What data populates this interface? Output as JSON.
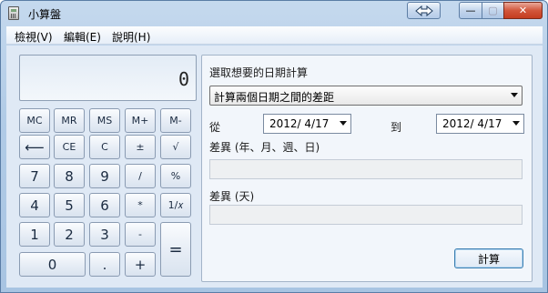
{
  "window": {
    "title": "小算盤"
  },
  "titlebar_buttons": {
    "unit_icon": "swap-arrows-icon",
    "min_label": "—",
    "max_label": "▢",
    "close_label": "✕"
  },
  "menu": [
    "檢視(V)",
    "編輯(E)",
    "說明(H)"
  ],
  "calculator": {
    "display": "0",
    "keys": {
      "mc": "MC",
      "mr": "MR",
      "ms": "MS",
      "mplus": "M+",
      "mminus": "M-",
      "back": "⟵",
      "ce": "CE",
      "c": "C",
      "sign": "±",
      "sqrt": "√",
      "n7": "7",
      "n8": "8",
      "n9": "9",
      "div": "/",
      "pct": "%",
      "n4": "4",
      "n5": "5",
      "n6": "6",
      "mul": "*",
      "inv": "1/𝑥",
      "n1": "1",
      "n2": "2",
      "n3": "3",
      "sub": "-",
      "eq": "=",
      "n0": "0",
      "dot": ".",
      "add": "+"
    }
  },
  "date_panel": {
    "prompt": "選取想要的日期計算",
    "mode": "計算兩個日期之間的差距",
    "from_label": "從",
    "from_date": "2012/  4/17",
    "to_label": "到",
    "to_date": "2012/  4/17",
    "diff_label": "差異 (年、月、週、日)",
    "diff_days_label": "差異 (天)",
    "calc_button": "計算"
  }
}
